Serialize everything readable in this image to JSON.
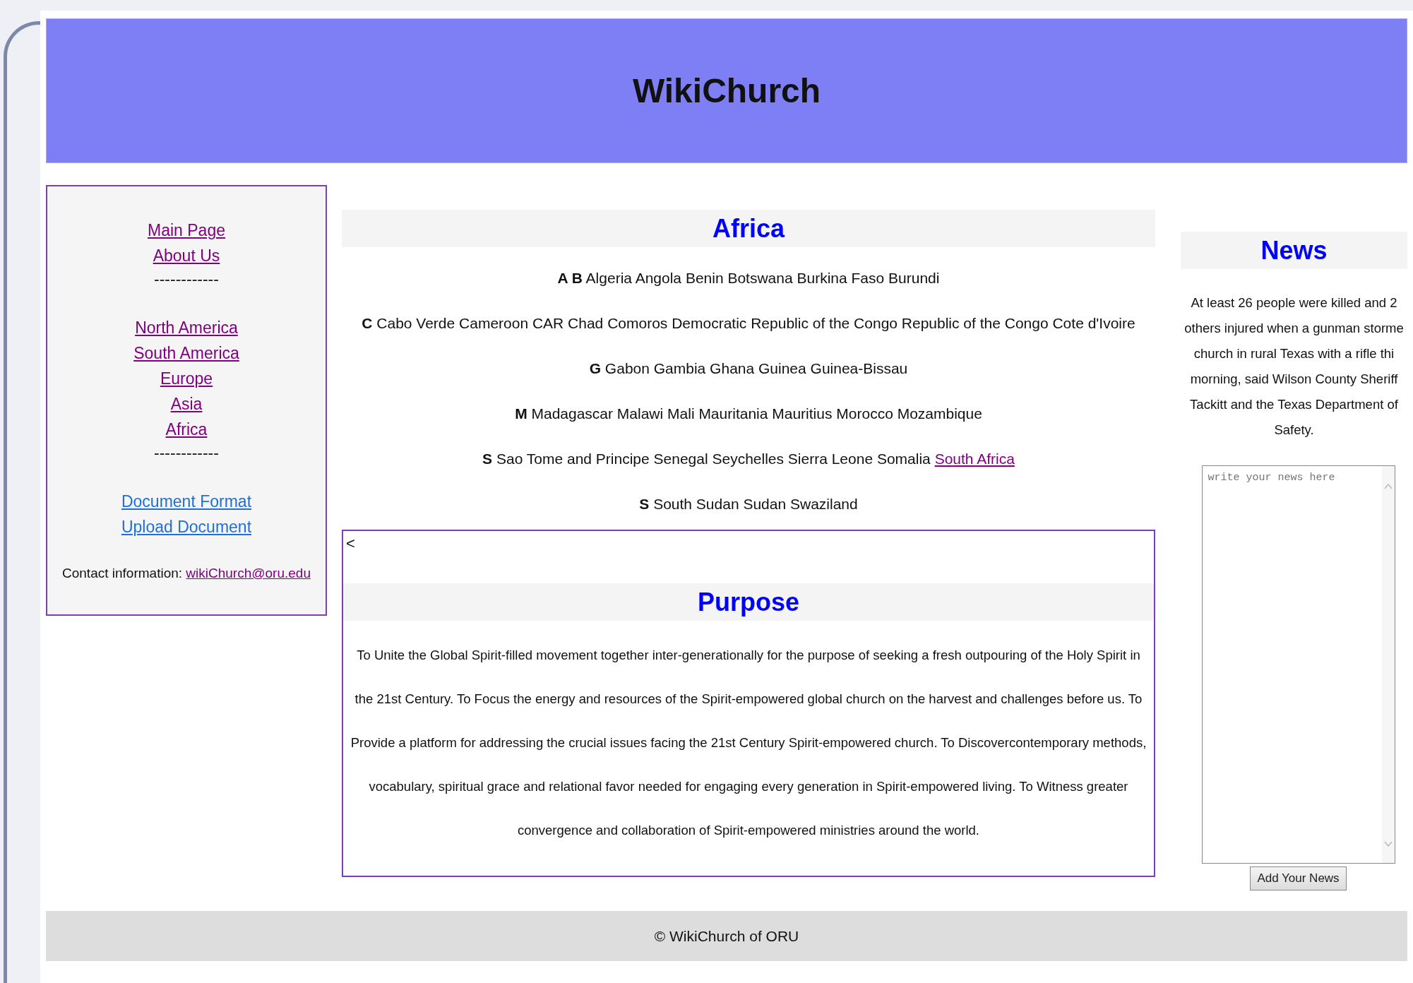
{
  "header": {
    "title": "WikiChurch"
  },
  "sidebar": {
    "items": [
      {
        "kind": "link",
        "label": "Main Page",
        "visited": true
      },
      {
        "kind": "link",
        "label": "About Us",
        "visited": true
      },
      {
        "kind": "separator",
        "label": "------------"
      },
      {
        "kind": "link",
        "label": "North America",
        "visited": true
      },
      {
        "kind": "link",
        "label": "South America",
        "visited": true
      },
      {
        "kind": "link",
        "label": "Europe",
        "visited": true
      },
      {
        "kind": "link",
        "label": "Asia",
        "visited": true
      },
      {
        "kind": "link",
        "label": "Africa",
        "visited": true
      },
      {
        "kind": "separator",
        "label": "------------"
      },
      {
        "kind": "link",
        "label": "Document Format",
        "visited": false
      },
      {
        "kind": "link",
        "label": "Upload Document",
        "visited": false
      }
    ],
    "contact": {
      "label": "Contact information:",
      "email": "wikiChurch@oru.edu"
    }
  },
  "africa": {
    "title": "Africa",
    "rows": [
      {
        "text": "**A B** Algeria Angola Benin Botswana Burkina Faso Burundi"
      },
      {
        "text": "**C** Cabo Verde Cameroon CAR Chad Comoros Democratic Republic of the Congo Republic of the Congo Cote d'Ivoire"
      },
      {
        "text": "**G** Gabon Gambia Ghana Guinea Guinea-Bissau"
      },
      {
        "text": "**M** Madagascar Malawi Mali Mauritania Mauritius Morocco Mozambique"
      },
      {
        "text": "**S** Sao Tome and Principe Senegal Seychelles Sierra Leone Somalia",
        "link": "South Africa"
      },
      {
        "text": "**S** South Sudan Sudan Swaziland"
      }
    ]
  },
  "purpose": {
    "marker": "<",
    "title": "Purpose",
    "text": "To Unite the Global Spirit-filled movement together inter-generationally for the purpose of seeking a fresh outpouring of the Holy Spirit in the 21st Century. To Focus the energy and resources of the Spirit-empowered global church on the harvest and challenges before us. To Provide a platform for addressing the crucial issues facing the 21st Century Spirit-empowered church. To Discovercontemporary methods, vocabulary, spiritual grace and relational favor needed for engaging every generation in Spirit-empowered living. To Witness greater convergence and collaboration of Spirit-empowered ministries around the world."
  },
  "news": {
    "title": "News",
    "lines": [
      "At least 26 people were killed and 2",
      "others injured when a gunman storme",
      "church in rural Texas with a rifle thi",
      "morning, said Wilson County Sheriff",
      "Tackitt and the Texas Department of",
      "Safety."
    ],
    "input": {
      "placeholder": "write your news here"
    },
    "button": "Add Your News"
  },
  "footer": {
    "text": "© WikiChurch of ORU"
  }
}
